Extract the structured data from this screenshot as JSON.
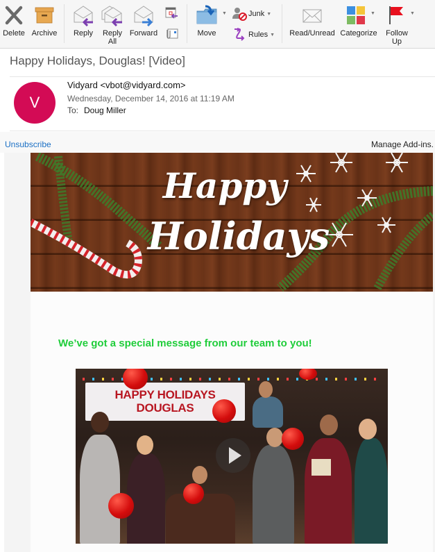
{
  "toolbar": {
    "delete": "Delete",
    "archive": "Archive",
    "reply": "Reply",
    "reply_all": "Reply\nAll",
    "forward": "Forward",
    "move": "Move",
    "junk": "Junk",
    "rules": "Rules",
    "read_unread": "Read/Unread",
    "categorize": "Categorize",
    "follow_up": "Follow\nUp"
  },
  "message": {
    "subject": "Happy Holidays, Douglas! [Video]",
    "avatar_initial": "V",
    "avatar_color": "#d30b55",
    "from": "Vidyard <vbot@vidyard.com>",
    "date": "Wednesday, December 14, 2016 at 11:19 AM",
    "to_label": "To:",
    "to_name": "Doug Miller"
  },
  "addins": {
    "unsubscribe": "Unsubscribe",
    "manage": "Manage Add-ins."
  },
  "email": {
    "banner_line1": "Happy",
    "banner_line2": "Holidays",
    "tagline": "We’ve got a special message from our team to you!",
    "tagline_color": "#1fcd3a",
    "video_sign_line1": "HAPPY HOLIDAYS",
    "video_sign_line2": "DOUGLAS"
  }
}
